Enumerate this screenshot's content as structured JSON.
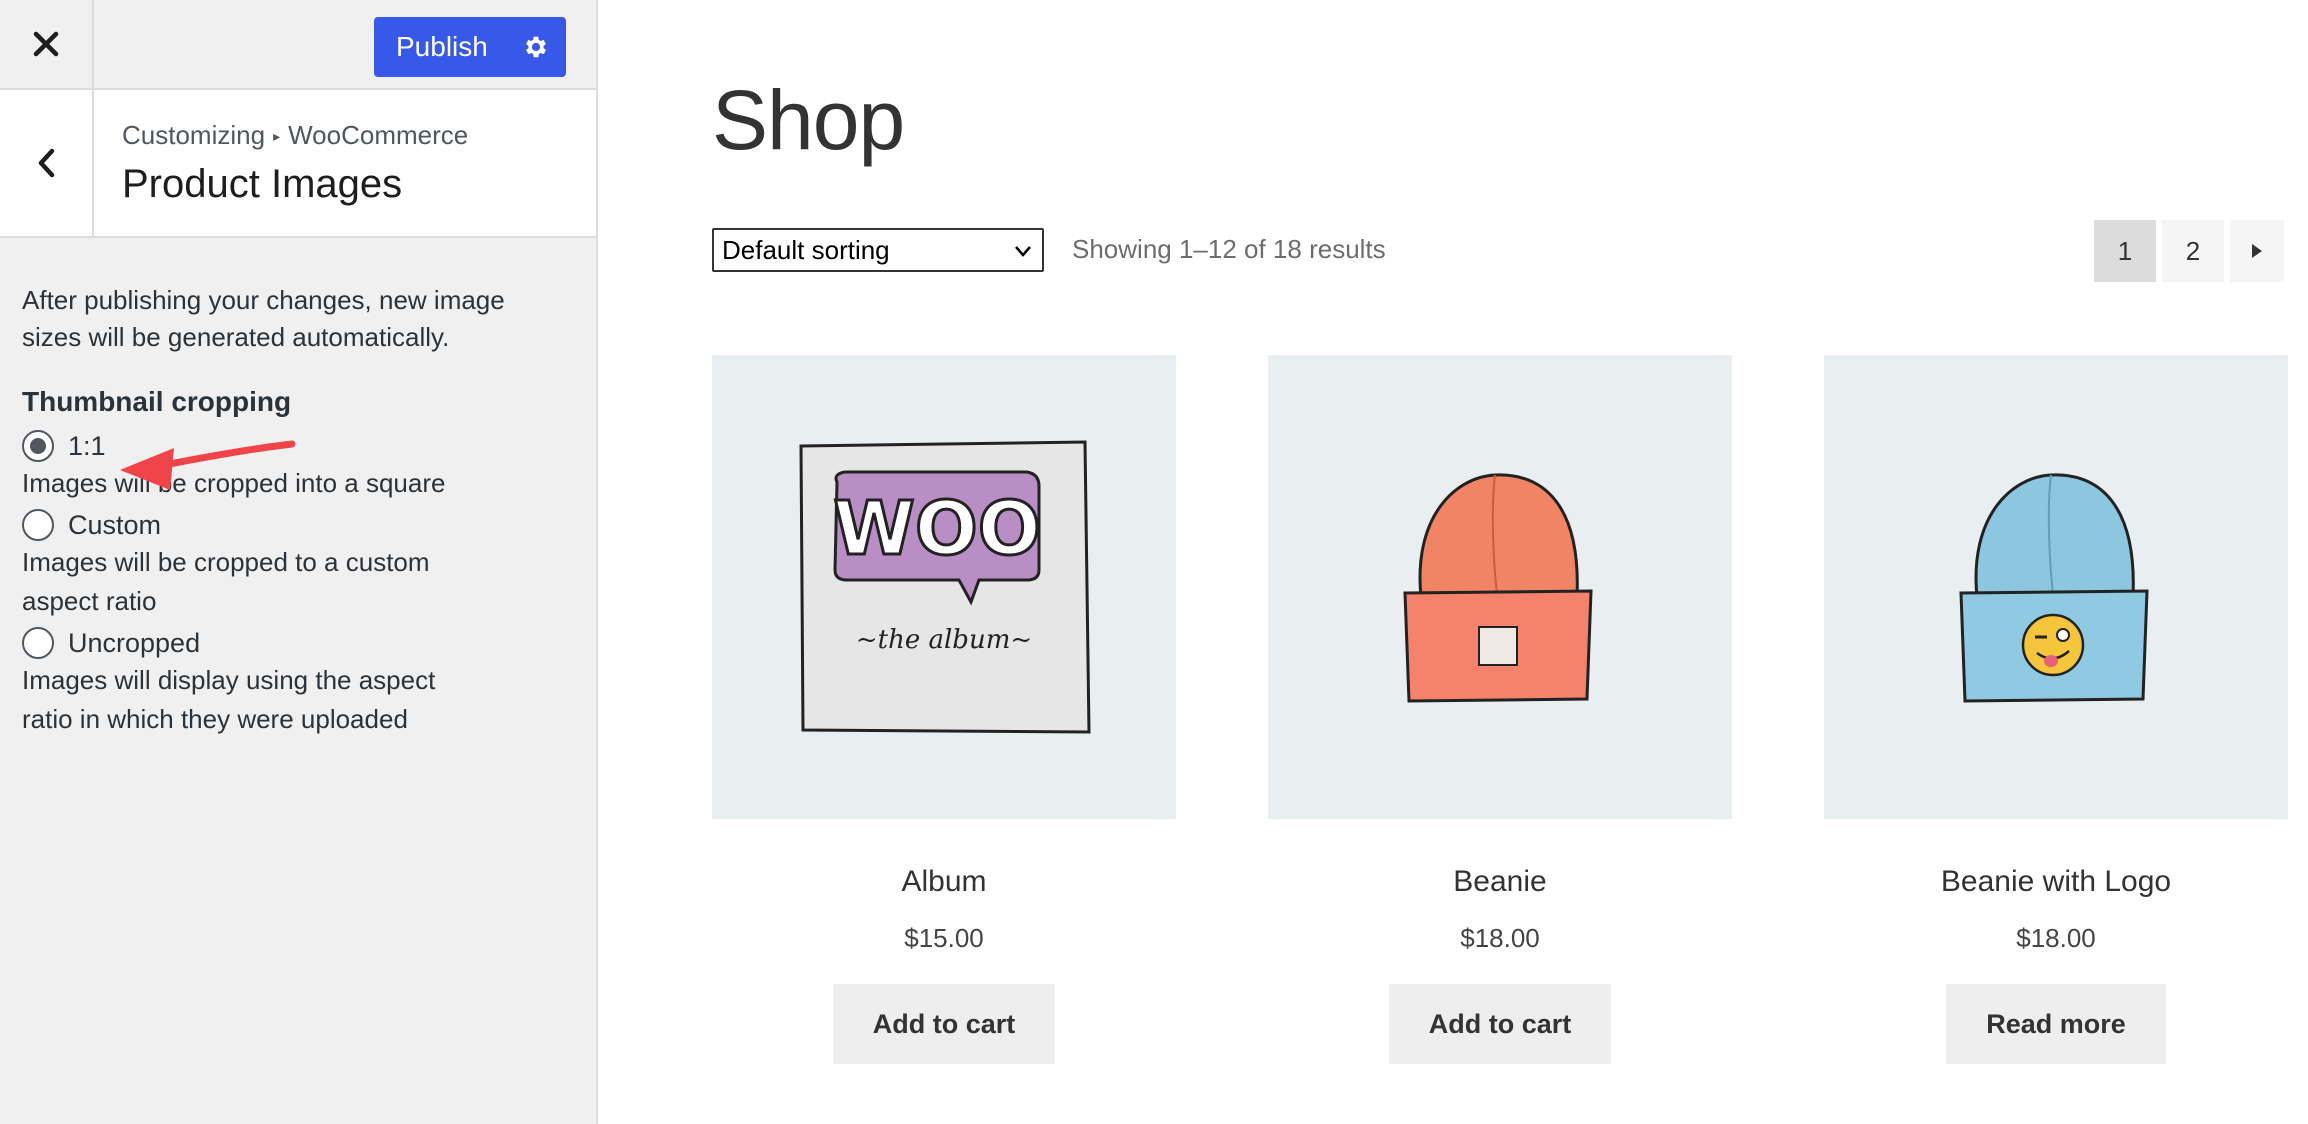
{
  "header": {
    "close_icon": "close-icon",
    "publish_label": "Publish",
    "settings_icon": "gear-icon",
    "accent": "#3858e9"
  },
  "section": {
    "back_icon": "chevron-left-icon",
    "breadcrumb_root": "Customizing",
    "breadcrumb_separator": "▸",
    "breadcrumb_current": "WooCommerce",
    "title": "Product Images"
  },
  "panel": {
    "notice": "After publishing your changes, new image sizes will be generated automatically.",
    "group_title": "Thumbnail cropping",
    "options": [
      {
        "label": "1:1",
        "description": "Images will be cropped into a square",
        "selected": true
      },
      {
        "label": "Custom",
        "description": "Images will be cropped to a custom aspect ratio",
        "selected": false
      },
      {
        "label": "Uncropped",
        "description": "Images will display using the aspect ratio in which they were uploaded",
        "selected": false
      }
    ],
    "annotation_color": "#f0444b"
  },
  "shop": {
    "title": "Shop",
    "sort_selected": "Default sorting",
    "result_count": "Showing 1–12 of 18 results",
    "pagination": {
      "pages": [
        "1",
        "2"
      ],
      "current": "1",
      "next_icon": "caret-right-icon"
    },
    "products": [
      {
        "name": "Album",
        "price": "$15.00",
        "button": "Add to cart",
        "image_icon": "woo-album-image"
      },
      {
        "name": "Beanie",
        "price": "$18.00",
        "button": "Add to cart",
        "image_icon": "orange-beanie-image"
      },
      {
        "name": "Beanie with Logo",
        "price": "$18.00",
        "button": "Read more",
        "image_icon": "blue-beanie-logo-image"
      }
    ],
    "woo_text": "WOO",
    "album_text": "~the album~"
  }
}
